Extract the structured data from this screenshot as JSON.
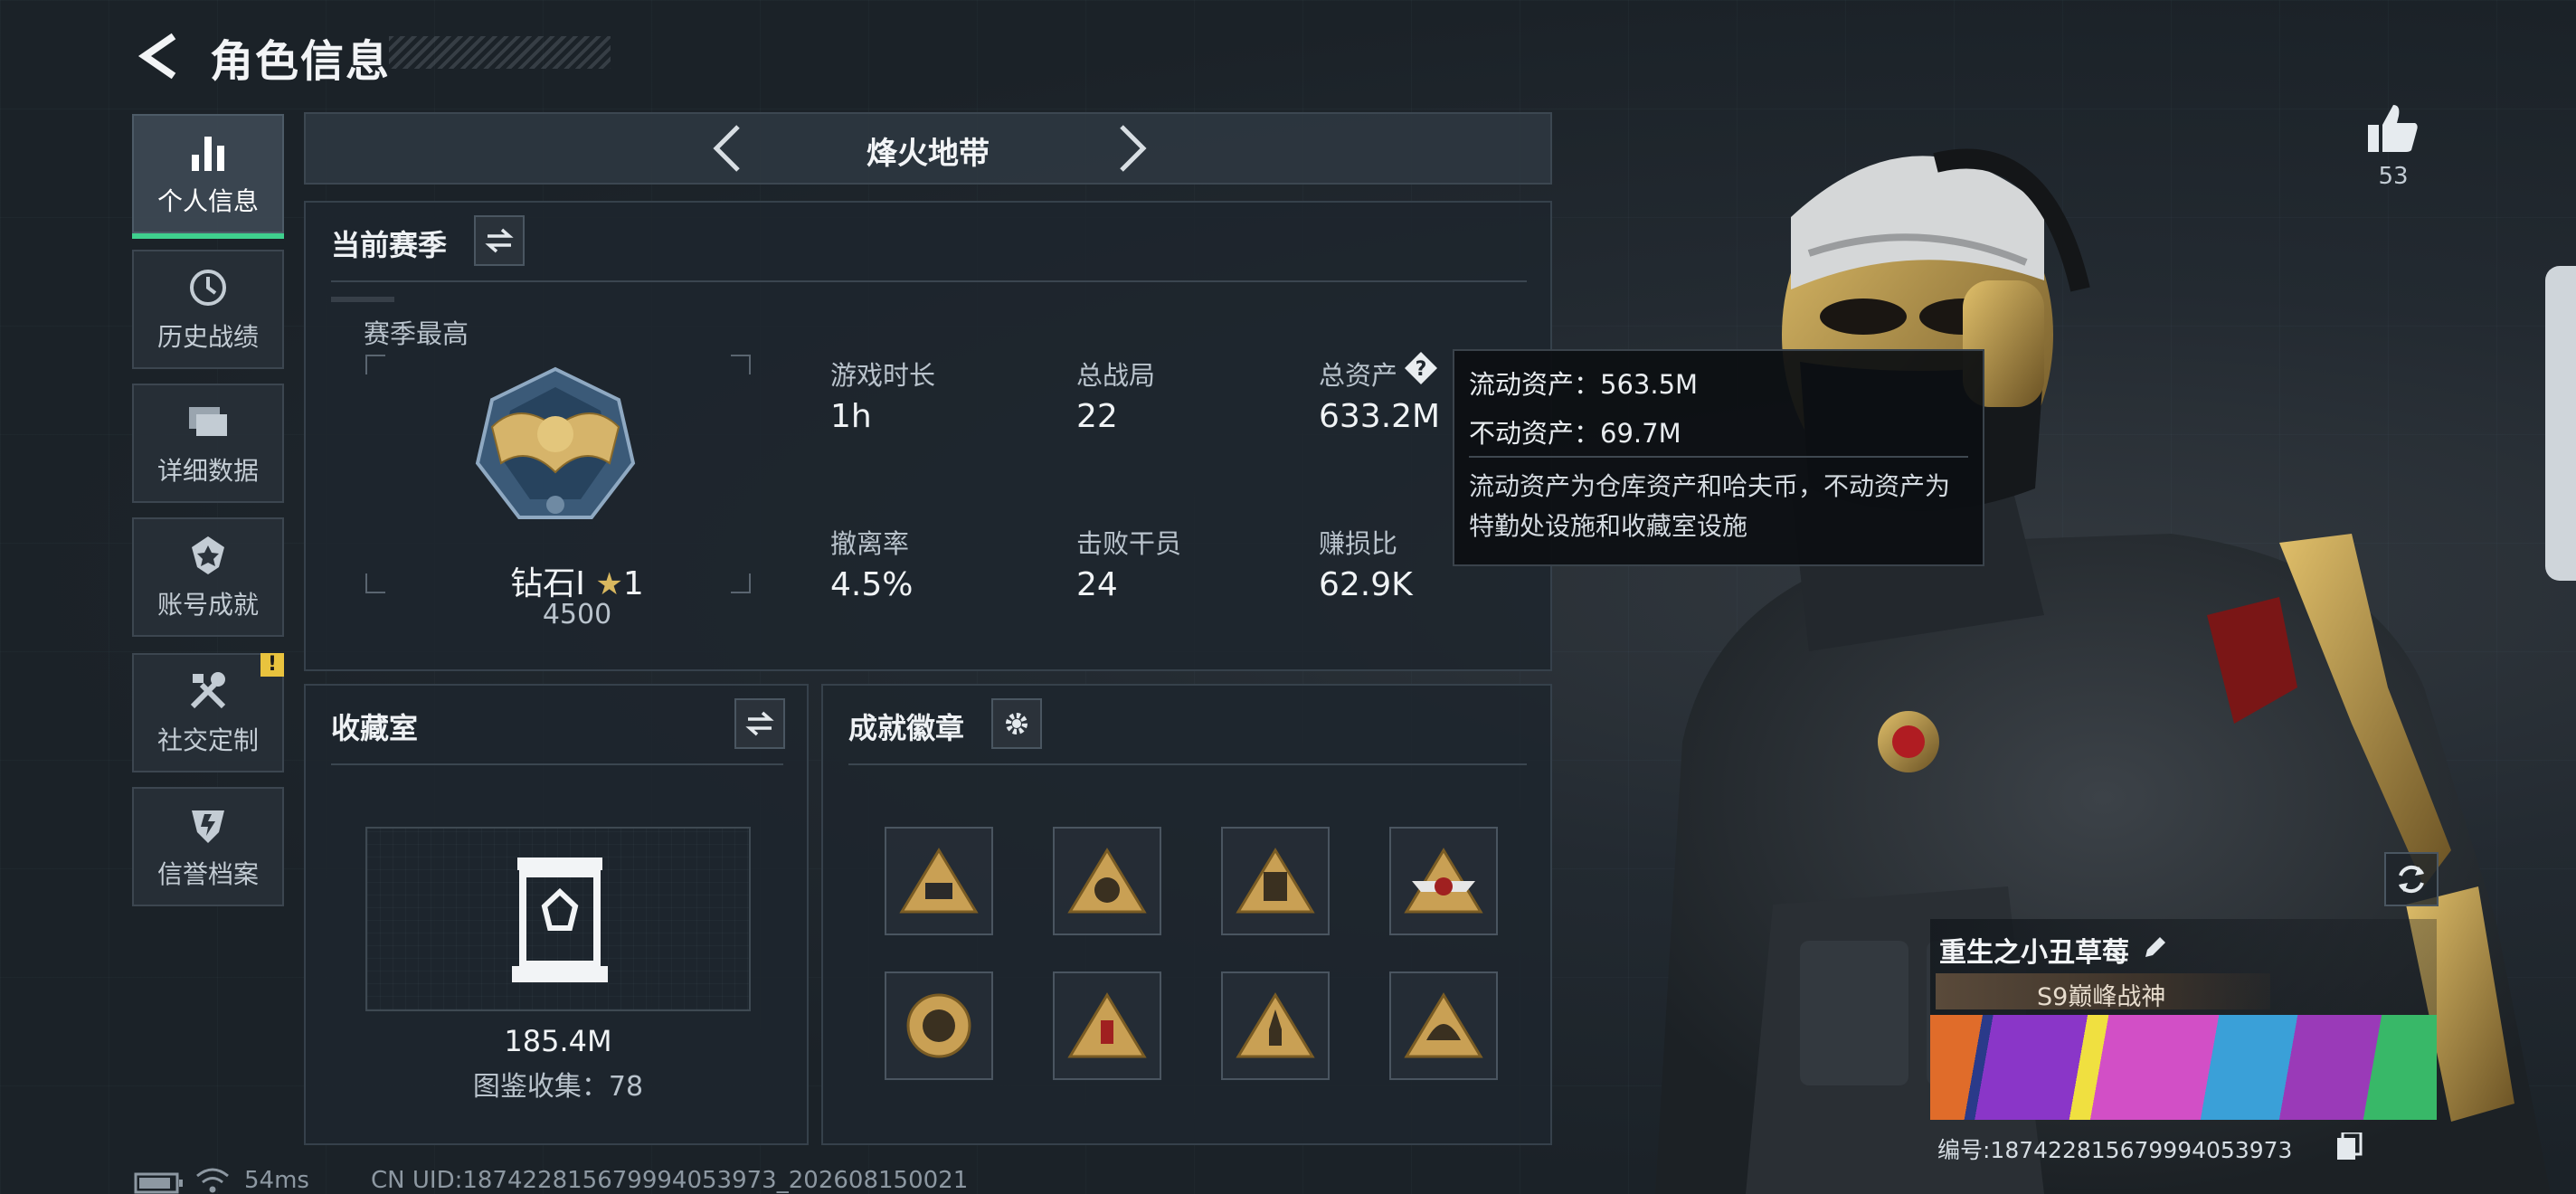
{
  "header": {
    "title": "角色信息"
  },
  "nav": {
    "items": [
      {
        "label": "个人信息",
        "icon": "bar-chart-icon",
        "active": true
      },
      {
        "label": "历史战绩",
        "icon": "history-icon",
        "active": false
      },
      {
        "label": "详细数据",
        "icon": "folders-icon",
        "active": false
      },
      {
        "label": "账号成就",
        "icon": "achievement-icon",
        "active": false
      },
      {
        "label": "社交定制",
        "icon": "tools-icon",
        "active": false,
        "badge": "!"
      },
      {
        "label": "信誉档案",
        "icon": "credit-shield-icon",
        "active": false
      }
    ]
  },
  "mode": {
    "title": "烽火地带"
  },
  "season": {
    "title": "当前赛季",
    "best_label": "赛季最高",
    "rank_name": "钻石I",
    "rank_stars": "1",
    "rank_points": "4500",
    "stats": [
      {
        "label": "游戏时长",
        "value": "1h"
      },
      {
        "label": "总战局",
        "value": "22"
      },
      {
        "label": "总资产",
        "value": "633.2M"
      },
      {
        "label": "撤离率",
        "value": "4.5%"
      },
      {
        "label": "击败干员",
        "value": "24"
      },
      {
        "label": "赚损比",
        "value": "62.9K"
      }
    ]
  },
  "tooltip": {
    "liquid": "流动资产：563.5M",
    "fixed": "不动资产：69.7M",
    "desc": "流动资产为仓库资产和哈夫币，不动资产为特勤处设施和收藏室设施"
  },
  "collection": {
    "title": "收藏室",
    "value": "185.4M",
    "catalog": "图鉴收集：78"
  },
  "achievements": {
    "title": "成就徽章",
    "badges": [
      "badge-s4",
      "badge-s5",
      "badge-card",
      "badge-s9",
      "badge-circle",
      "badge-supply",
      "badge-rocket",
      "badge-helmet"
    ]
  },
  "likes": {
    "count": "53"
  },
  "operator": {
    "name": "重生之小丑草莓",
    "title": "S9巅峰战神",
    "id_line": "编号:187422815679994053973"
  },
  "footer": {
    "ping": "54ms",
    "uid": "CN UID:187422815679994053973_202608150021"
  },
  "colors": {
    "accent_green": "#3fd08e",
    "gold": "#c9a054",
    "warning": "#e9c33e"
  }
}
